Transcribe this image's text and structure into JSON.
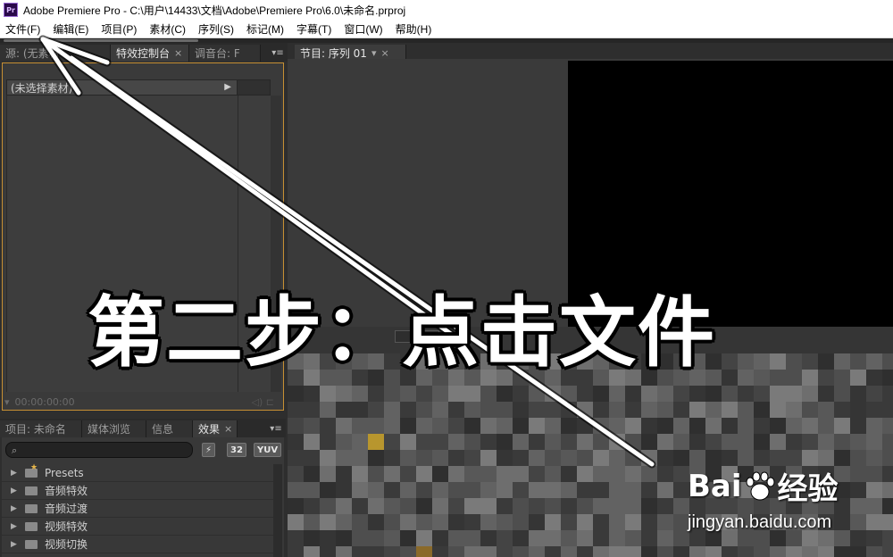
{
  "window": {
    "title": "Adobe Premiere Pro - C:\\用户\\14433\\文档\\Adobe\\Premiere Pro\\6.0\\未命名.prproj",
    "app_icon": "Pr"
  },
  "menu": [
    "文件(F)",
    "编辑(E)",
    "项目(P)",
    "素材(C)",
    "序列(S)",
    "标记(M)",
    "字幕(T)",
    "窗口(W)",
    "帮助(H)"
  ],
  "left_upper": {
    "tabs": [
      "源: (无素材",
      "特效控制台",
      "调音台: F"
    ],
    "header_label": "(未选择素材)",
    "timecode": "00:00:00:00"
  },
  "left_lower": {
    "tabs": [
      "项目: 未命名",
      "媒体浏览",
      "信息",
      "效果"
    ],
    "badges": [
      "32",
      "YUV"
    ],
    "effects": [
      "Presets",
      "音频特效",
      "音频过渡",
      "视频特效",
      "视频切换"
    ]
  },
  "program": {
    "tab": "节目: 序列 01"
  },
  "overlay": {
    "text": "第二步：点击文件",
    "arrow_color": "#ffffff"
  },
  "watermark": {
    "brand": "Bai",
    "brand_suffix": "经验",
    "url": "jingyan.baidu.com"
  },
  "colors": {
    "active_panel_border": "#c68f33",
    "panel_bg": "#3a3a3a"
  }
}
